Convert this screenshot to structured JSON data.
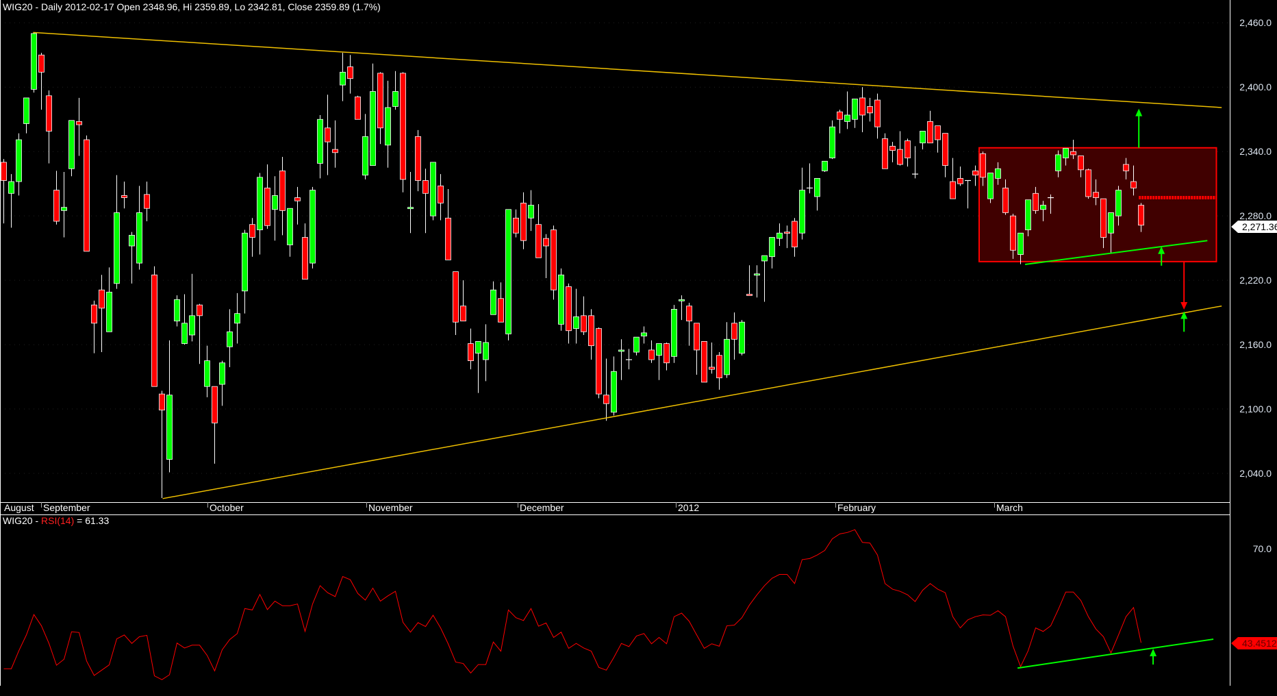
{
  "header": {
    "title": "WIG20 - Daily 2012-02-17 Open 2348.96, Hi 2359.89, Lo 2342.81, Close 2359.89 (1.7%)"
  },
  "price_axis": {
    "labels": [
      "2,460.0",
      "2,400.0",
      "2,340.0",
      "2,280.0",
      "2,220.0",
      "2,160.0",
      "2,100.0",
      "2,040.0"
    ],
    "last_price": "2,271.36"
  },
  "time_axis": {
    "months": [
      "August",
      "September",
      "October",
      "November",
      "December",
      "2012",
      "February",
      "March"
    ]
  },
  "rsi_pane": {
    "prefix": "WIG20 - ",
    "indicator": "RSI(14)",
    "suffix": " = 61.33",
    "axis_label": "70.0",
    "last_value": "43.4512"
  },
  "colors": {
    "up": "#00ff00",
    "down": "#ff0000",
    "trendline": "#f0c000",
    "box_fill": "#400000",
    "box_border": "#ff0000",
    "rsi": "#ff0000"
  },
  "chart_data": {
    "type": "candlestick",
    "title": "WIG20 - Daily",
    "ylim": [
      2010,
      2475
    ],
    "yticks": [
      2460,
      2400,
      2340,
      2280,
      2220,
      2160,
      2100,
      2040
    ],
    "ohlc": [
      [
        2330,
        2333,
        2273,
        2313
      ],
      [
        2301,
        2319,
        2269,
        2312
      ],
      [
        2312,
        2357,
        2299,
        2351
      ],
      [
        2366,
        2390,
        2357,
        2390
      ],
      [
        2398,
        2451,
        2395,
        2450
      ],
      [
        2430,
        2432,
        2379,
        2414
      ],
      [
        2392,
        2397,
        2329,
        2359
      ],
      [
        2304,
        2322,
        2272,
        2275
      ],
      [
        2285,
        2321,
        2260,
        2288
      ],
      [
        2324,
        2369,
        2317,
        2369
      ],
      [
        2368,
        2390,
        2336,
        2365
      ],
      [
        2351,
        2355,
        2247,
        2247
      ],
      [
        2197,
        2201,
        2152,
        2180
      ],
      [
        2211,
        2225,
        2153,
        2194
      ],
      [
        2172,
        2232,
        2172,
        2209
      ],
      [
        2217,
        2318,
        2212,
        2283
      ],
      [
        2299,
        2312,
        2287,
        2297
      ],
      [
        2252,
        2265,
        2217,
        2262
      ],
      [
        2236,
        2308,
        2230,
        2283
      ],
      [
        2300,
        2312,
        2275,
        2287
      ],
      [
        2225,
        2233,
        2121,
        2121
      ],
      [
        2114,
        2117,
        2017,
        2099
      ],
      [
        2053,
        2164,
        2041,
        2113
      ],
      [
        2182,
        2206,
        2177,
        2202
      ],
      [
        2161,
        2207,
        2160,
        2180
      ],
      [
        2169,
        2226,
        2163,
        2187
      ],
      [
        2197,
        2198,
        2142,
        2187
      ],
      [
        2121,
        2159,
        2111,
        2145
      ],
      [
        2121,
        2121,
        2049,
        2087
      ],
      [
        2123,
        2145,
        2103,
        2143
      ],
      [
        2158,
        2193,
        2139,
        2172
      ],
      [
        2180,
        2208,
        2161,
        2189
      ],
      [
        2210,
        2267,
        2189,
        2264
      ],
      [
        2272,
        2278,
        2242,
        2260
      ],
      [
        2267,
        2320,
        2244,
        2316
      ],
      [
        2306,
        2328,
        2268,
        2271
      ],
      [
        2286,
        2317,
        2257,
        2299
      ],
      [
        2322,
        2335,
        2262,
        2285
      ],
      [
        2253,
        2287,
        2242,
        2287
      ],
      [
        2297,
        2307,
        2272,
        2294
      ],
      [
        2260,
        2273,
        2221,
        2221
      ],
      [
        2236,
        2307,
        2231,
        2304
      ],
      [
        2329,
        2374,
        2315,
        2370
      ],
      [
        2362,
        2393,
        2318,
        2349
      ],
      [
        2342,
        2369,
        2325,
        2339
      ],
      [
        2402,
        2432,
        2387,
        2414
      ],
      [
        2419,
        2430,
        2394,
        2408
      ],
      [
        2391,
        2392,
        2370,
        2370
      ],
      [
        2318,
        2375,
        2314,
        2354
      ],
      [
        2327,
        2422,
        2327,
        2396
      ],
      [
        2413,
        2414,
        2347,
        2362
      ],
      [
        2346,
        2406,
        2325,
        2381
      ],
      [
        2382,
        2415,
        2379,
        2396
      ],
      [
        2413,
        2414,
        2302,
        2314
      ],
      [
        2287,
        2321,
        2264,
        2288
      ],
      [
        2354,
        2360,
        2303,
        2313
      ],
      [
        2313,
        2324,
        2264,
        2301
      ],
      [
        2280,
        2330,
        2276,
        2330
      ],
      [
        2308,
        2319,
        2276,
        2292
      ],
      [
        2278,
        2305,
        2239,
        2239
      ],
      [
        2228,
        2228,
        2169,
        2181
      ],
      [
        2196,
        2220,
        2182,
        2182
      ],
      [
        2161,
        2175,
        2137,
        2145
      ],
      [
        2152,
        2163,
        2115,
        2163
      ],
      [
        2146,
        2179,
        2126,
        2162
      ],
      [
        2188,
        2219,
        2188,
        2211
      ],
      [
        2203,
        2218,
        2181,
        2181
      ],
      [
        2170,
        2286,
        2164,
        2286
      ],
      [
        2278,
        2286,
        2260,
        2264
      ],
      [
        2292,
        2302,
        2249,
        2257
      ],
      [
        2278,
        2304,
        2266,
        2290
      ],
      [
        2272,
        2291,
        2241,
        2241
      ],
      [
        2259,
        2263,
        2222,
        2252
      ],
      [
        2267,
        2271,
        2202,
        2211
      ],
      [
        2179,
        2231,
        2173,
        2225
      ],
      [
        2214,
        2217,
        2161,
        2173
      ],
      [
        2175,
        2212,
        2161,
        2186
      ],
      [
        2187,
        2205,
        2169,
        2172
      ],
      [
        2187,
        2193,
        2146,
        2159
      ],
      [
        2175,
        2176,
        2110,
        2114
      ],
      [
        2113,
        2147,
        2089,
        2105
      ],
      [
        2097,
        2149,
        2094,
        2135
      ],
      [
        2154,
        2165,
        2127,
        2155
      ],
      [
        2146,
        2156,
        2137,
        2146
      ],
      [
        2153,
        2167,
        2150,
        2167
      ],
      [
        2168,
        2177,
        2161,
        2171
      ],
      [
        2155,
        2164,
        2143,
        2146
      ],
      [
        2150,
        2161,
        2127,
        2161
      ],
      [
        2161,
        2162,
        2136,
        2143
      ],
      [
        2149,
        2197,
        2143,
        2193
      ],
      [
        2201,
        2206,
        2183,
        2202
      ],
      [
        2196,
        2199,
        2159,
        2182
      ],
      [
        2180,
        2180,
        2132,
        2155
      ],
      [
        2163,
        2163,
        2125,
        2125
      ],
      [
        2139,
        2162,
        2133,
        2137
      ],
      [
        2150,
        2153,
        2118,
        2129
      ],
      [
        2132,
        2181,
        2129,
        2165
      ],
      [
        2180,
        2190,
        2146,
        2165
      ],
      [
        2152,
        2183,
        2150,
        2181
      ],
      [
        2207,
        2234,
        2206,
        2206
      ],
      [
        2225,
        2234,
        2204,
        2226
      ],
      [
        2238,
        2243,
        2200,
        2243
      ],
      [
        2242,
        2260,
        2231,
        2260
      ],
      [
        2259,
        2273,
        2252,
        2264
      ],
      [
        2265,
        2271,
        2250,
        2264
      ],
      [
        2275,
        2278,
        2242,
        2251
      ],
      [
        2264,
        2325,
        2258,
        2304
      ],
      [
        2306,
        2329,
        2301,
        2306
      ],
      [
        2298,
        2315,
        2285,
        2315
      ],
      [
        2322,
        2331,
        2321,
        2331
      ],
      [
        2334,
        2369,
        2333,
        2363
      ],
      [
        2377,
        2379,
        2357,
        2370
      ],
      [
        2368,
        2396,
        2361,
        2374
      ],
      [
        2370,
        2389,
        2362,
        2389
      ],
      [
        2390,
        2400,
        2358,
        2374
      ],
      [
        2382,
        2390,
        2368,
        2376
      ],
      [
        2388,
        2394,
        2352,
        2363
      ],
      [
        2352,
        2357,
        2324,
        2324
      ],
      [
        2345,
        2349,
        2330,
        2341
      ],
      [
        2342,
        2359,
        2327,
        2328
      ],
      [
        2350,
        2352,
        2326,
        2334
      ],
      [
        2319,
        2345,
        2315,
        2319
      ],
      [
        2348,
        2359,
        2342,
        2359
      ],
      [
        2368,
        2378,
        2348,
        2348
      ],
      [
        2364,
        2364,
        2339,
        2351
      ],
      [
        2357,
        2357,
        2316,
        2327
      ],
      [
        2312,
        2334,
        2296,
        2296
      ],
      [
        2315,
        2326,
        2308,
        2310
      ],
      [
        2313,
        2313,
        2287,
        2313
      ],
      [
        2322,
        2327,
        2308,
        2318
      ],
      [
        2338,
        2340,
        2308,
        2316
      ],
      [
        2296,
        2320,
        2292,
        2320
      ],
      [
        2315,
        2330,
        2309,
        2324
      ],
      [
        2306,
        2314,
        2281,
        2283
      ],
      [
        2280,
        2282,
        2240,
        2248
      ],
      [
        2244,
        2264,
        2235,
        2264
      ],
      [
        2267,
        2295,
        2261,
        2295
      ],
      [
        2301,
        2307,
        2282,
        2285
      ],
      [
        2286,
        2294,
        2275,
        2290
      ],
      [
        2297,
        2300,
        2282,
        2297
      ],
      [
        2322,
        2341,
        2316,
        2337
      ],
      [
        2334,
        2343,
        2327,
        2343
      ],
      [
        2340,
        2351,
        2333,
        2337
      ],
      [
        2336,
        2336,
        2316,
        2323
      ],
      [
        2323,
        2324,
        2296,
        2298
      ],
      [
        2302,
        2314,
        2290,
        2297
      ],
      [
        2296,
        2296,
        2250,
        2260
      ],
      [
        2264,
        2283,
        2245,
        2283
      ],
      [
        2280,
        2308,
        2271,
        2304
      ],
      [
        2328,
        2334,
        2314,
        2322
      ],
      [
        2312,
        2327,
        2299,
        2306
      ],
      [
        2290,
        2292,
        2265,
        2271.36
      ]
    ],
    "rsi": {
      "name": "RSI(14)",
      "ylim": [
        31,
        80
      ],
      "values": [
        36.1,
        36.1,
        41.2,
        45.7,
        51.5,
        48.3,
        43.3,
        37.1,
        38.8,
        46.6,
        46.4,
        38.3,
        34.2,
        35.7,
        37.2,
        44.6,
        45.7,
        43.3,
        45.2,
        45.6,
        34.1,
        33.0,
        34.4,
        43.4,
        42.0,
        42.8,
        42.8,
        39.9,
        35.5,
        41.5,
        44.4,
        46.1,
        53.2,
        52.8,
        57.2,
        52.9,
        55.3,
        54.0,
        54.0,
        54.5,
        46.7,
        54.5,
        59.7,
        57.7,
        56.6,
        62.3,
        61.4,
        57.5,
        55.6,
        59.0,
        55.3,
        56.8,
        58.1,
        49.3,
        46.5,
        49.2,
        48.1,
        51.3,
        47.7,
        43.2,
        38.0,
        37.6,
        34.9,
        37.3,
        37.3,
        43.7,
        41.1,
        52.8,
        50.6,
        49.8,
        53.2,
        48.2,
        49.1,
        45.0,
        46.5,
        41.9,
        43.3,
        42.0,
        41.1,
        36.5,
        35.7,
        39.3,
        43.3,
        42.4,
        45.4,
        46.1,
        43.2,
        45.0,
        43.2,
        50.9,
        51.9,
        49.6,
        45.7,
        41.9,
        43.2,
        42.5,
        48.3,
        48.5,
        50.6,
        54.2,
        57.1,
        59.7,
        61.8,
        62.9,
        62.9,
        60.3,
        67.1,
        67.4,
        68.4,
        69.7,
        73.0,
        74.4,
        74.8,
        75.6,
        72.0,
        71.8,
        68.4,
        60.3,
        58.7,
        58.1,
        57.1,
        55.2,
        58.4,
        60.3,
        58.7,
        57.7,
        50.9,
        47.7,
        50.0,
        50.9,
        51.4,
        51.3,
        52.6,
        50.9,
        42.5,
        36.7,
        41.2,
        47.7,
        46.7,
        48.3,
        52.9,
        57.9,
        57.9,
        55.5,
        50.9,
        47.4,
        45.2,
        40.6,
        45.7,
        50.9,
        53.5,
        43.5
      ]
    },
    "annotations": {
      "upper_trendline": [
        [
          3.9,
          2451
        ],
        [
          161.7,
          2381
        ]
      ],
      "lower_trendline": [
        [
          21.1,
          2016.5
        ],
        [
          161.7,
          2196
        ]
      ],
      "range_box": {
        "from_index": 129.5,
        "to_index": 161,
        "top": 2343.5,
        "bottom": 2237.4
      },
      "box_midline": {
        "from_index": 150.7,
        "to_index": 161,
        "price": 2297
      },
      "box_support_line": [
        [
          135.6,
          2234.8
        ],
        [
          159.8,
          2257
        ]
      ],
      "arrows": [
        {
          "index": 150.7,
          "from": 2343.5,
          "to": 2380,
          "color": "up"
        },
        {
          "index": 153.7,
          "from": 2233.6,
          "to": 2251.5,
          "color": "up"
        },
        {
          "index": 156.7,
          "from": 2237.4,
          "to": 2192.6,
          "color": "down"
        },
        {
          "index": 156.7,
          "from": 2172,
          "to": 2191,
          "color": "up"
        }
      ],
      "rsi_support_line": [
        [
          134.6,
          36.3
        ],
        [
          160.6,
          44.5
        ]
      ],
      "rsi_arrow": {
        "index": 152.6,
        "from": 37.3,
        "to": 41.8
      }
    }
  }
}
